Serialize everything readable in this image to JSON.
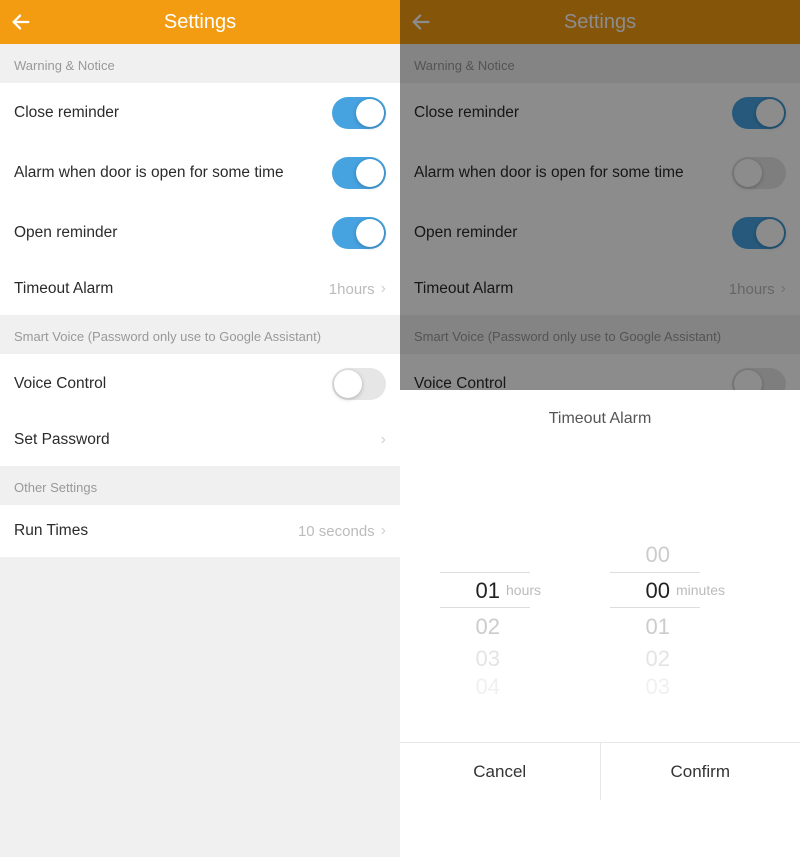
{
  "colors": {
    "accent": "#f39c12",
    "toggle_on": "#46a3e0"
  },
  "header": {
    "title": "Settings"
  },
  "sections": {
    "warning": {
      "label": "Warning & Notice",
      "rows": {
        "close_reminder": {
          "label": "Close reminder"
        },
        "alarm_open": {
          "label": "Alarm when door is open for some time"
        },
        "open_reminder": {
          "label": "Open reminder"
        },
        "timeout_alarm": {
          "label": "Timeout Alarm",
          "value": "1hours"
        }
      }
    },
    "smart_voice": {
      "label": "Smart Voice (Password only use to Google Assistant)",
      "rows": {
        "voice_control": {
          "label": "Voice Control"
        },
        "set_password": {
          "label": "Set Password"
        }
      }
    },
    "other": {
      "label": "Other Settings",
      "rows": {
        "run_times": {
          "label": "Run Times",
          "value": "10 seconds"
        }
      }
    }
  },
  "left_state": {
    "close_reminder_on": true,
    "alarm_open_on": true,
    "open_reminder_on": true,
    "voice_control_on": false
  },
  "right_state": {
    "close_reminder_on": true,
    "alarm_open_on": false,
    "open_reminder_on": true,
    "voice_control_on": false
  },
  "modal": {
    "title": "Timeout Alarm",
    "hours_unit": "hours",
    "minutes_unit": "minutes",
    "hours": {
      "prev_items": [],
      "selected": "01",
      "next_items": [
        "02",
        "03",
        "04"
      ]
    },
    "minutes": {
      "prev_items": [
        "00"
      ],
      "selected": "00",
      "next_items": [
        "01",
        "02",
        "03"
      ]
    },
    "cancel": "Cancel",
    "confirm": "Confirm"
  }
}
